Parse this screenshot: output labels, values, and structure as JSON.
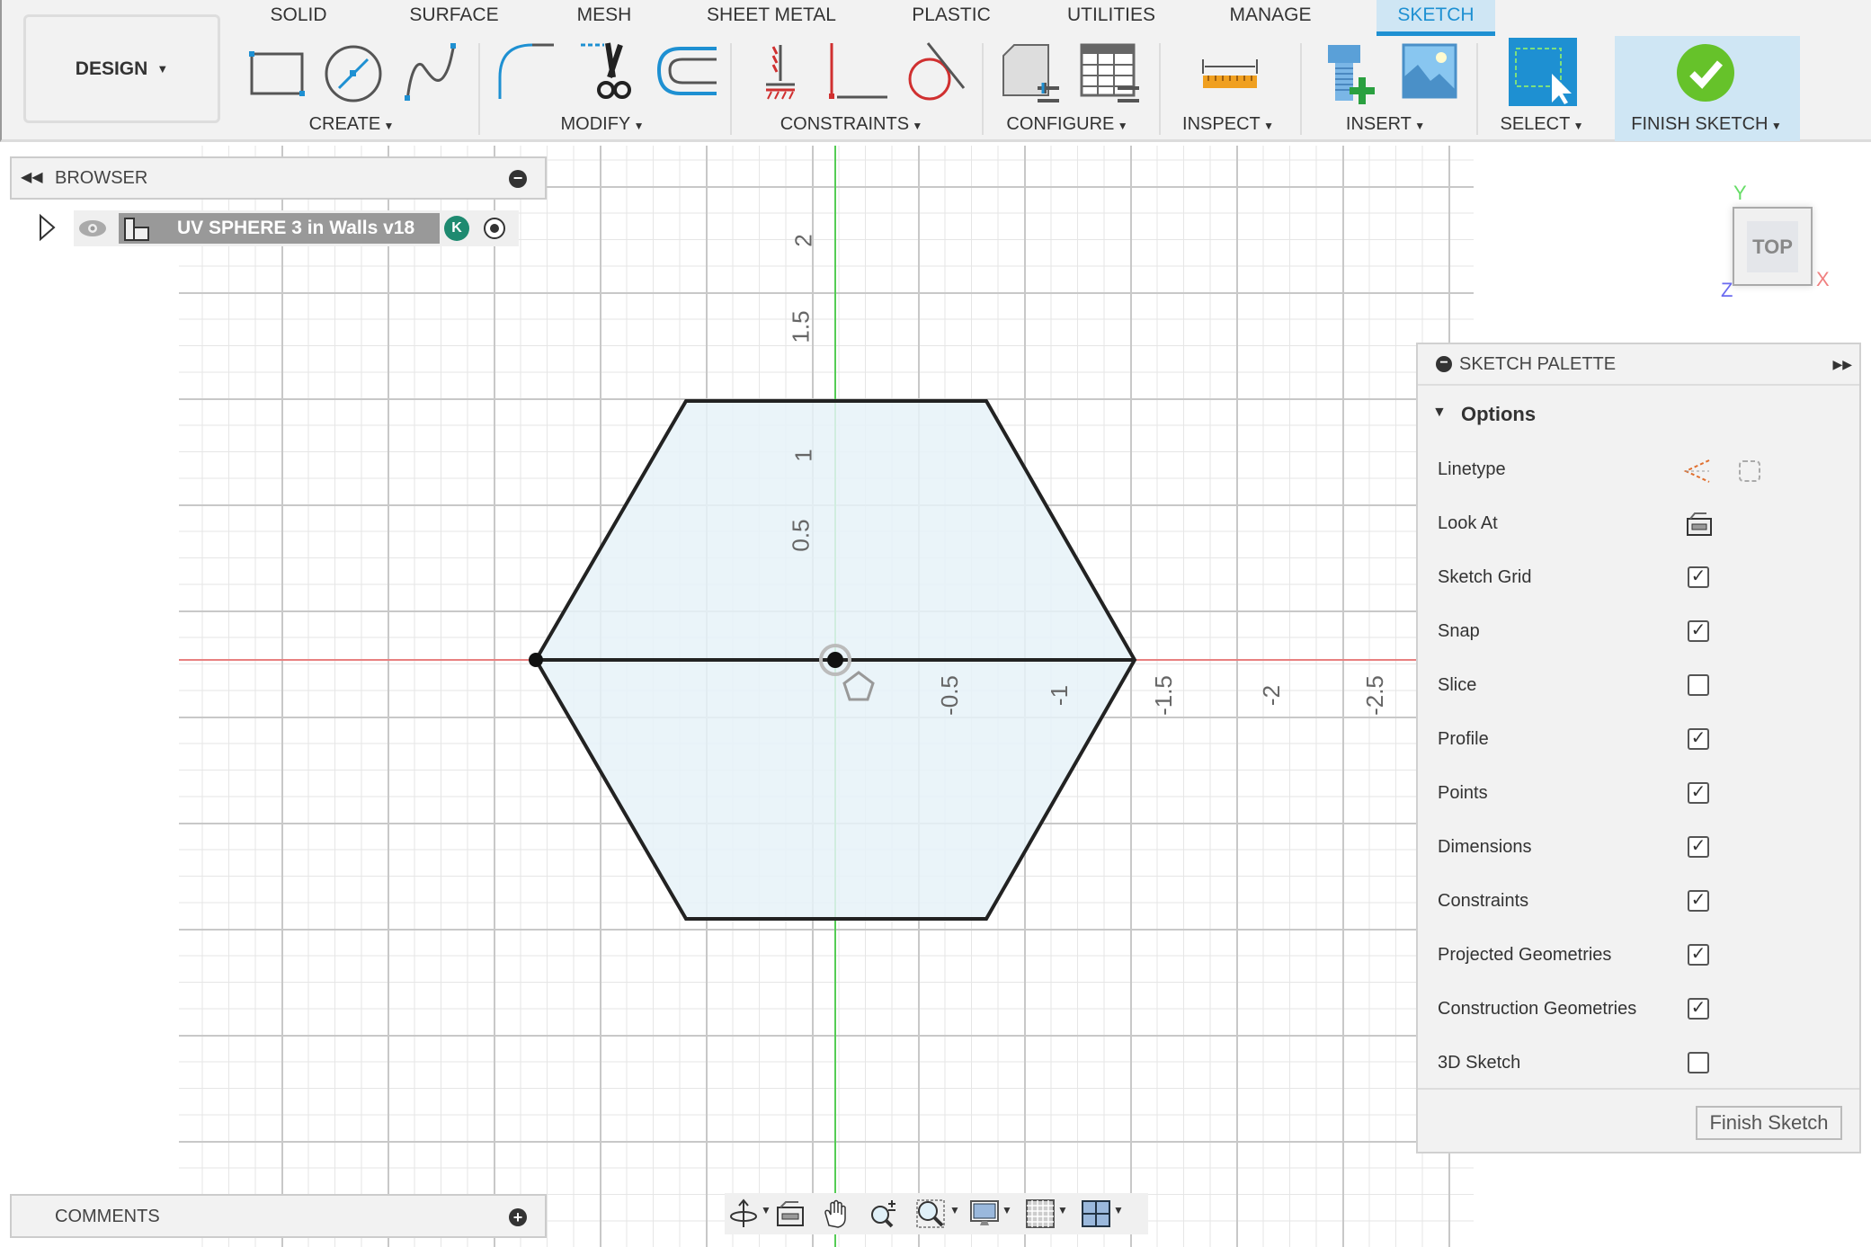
{
  "tabs": [
    "SOLID",
    "SURFACE",
    "MESH",
    "SHEET METAL",
    "PLASTIC",
    "UTILITIES",
    "MANAGE",
    "SKETCH"
  ],
  "active_tab": "SKETCH",
  "workspace": "DESIGN",
  "groups": [
    "CREATE",
    "MODIFY",
    "CONSTRAINTS",
    "CONFIGURE",
    "INSPECT",
    "INSERT",
    "SELECT",
    "FINISH SKETCH"
  ],
  "browser": {
    "title": "BROWSER",
    "item": "UV SPHERE 3 in Walls v18",
    "badge": "K"
  },
  "comments": {
    "title": "COMMENTS"
  },
  "viewcube": {
    "face": "TOP",
    "x": "X",
    "y": "Y",
    "z": "Z"
  },
  "axis_labels": {
    "y": [
      "2",
      "1.5",
      "1",
      "0.5"
    ],
    "x": [
      "-0.5",
      "-1",
      "-1.5",
      "-2",
      "-2.5"
    ]
  },
  "palette": {
    "title": "SKETCH PALETTE",
    "section": "Options",
    "rows": [
      {
        "label": "Linetype",
        "type": "icons"
      },
      {
        "label": "Look At",
        "type": "icon"
      },
      {
        "label": "Sketch Grid",
        "checked": true
      },
      {
        "label": "Snap",
        "checked": true
      },
      {
        "label": "Slice",
        "checked": false
      },
      {
        "label": "Profile",
        "checked": true
      },
      {
        "label": "Points",
        "checked": true
      },
      {
        "label": "Dimensions",
        "checked": true
      },
      {
        "label": "Constraints",
        "checked": true
      },
      {
        "label": "Projected Geometries",
        "checked": true
      },
      {
        "label": "Construction Geometries",
        "checked": true
      },
      {
        "label": "3D Sketch",
        "checked": false
      }
    ],
    "finish_button": "Finish Sketch"
  },
  "colors": {
    "accent": "#1e90d2",
    "x_axis": "#e88080",
    "y_axis": "#55cc55",
    "profile_fill": "#e6f2f8",
    "finish_green": "#66c22a"
  }
}
